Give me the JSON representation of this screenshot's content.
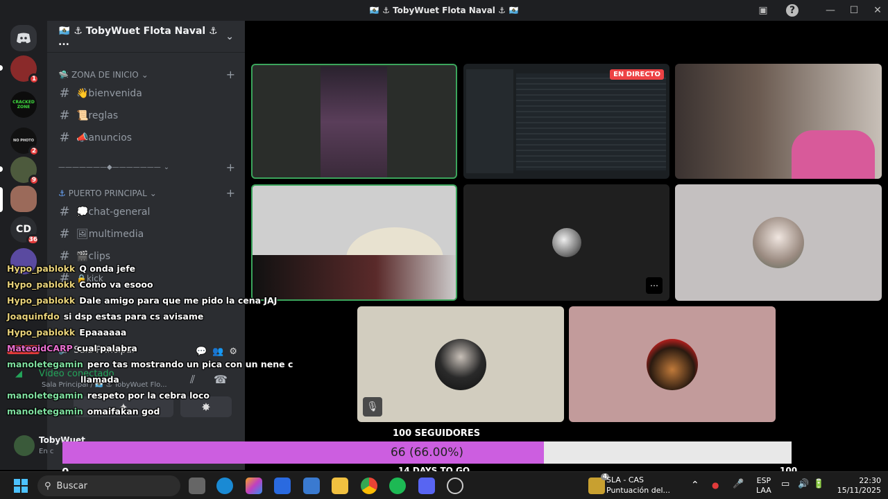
{
  "titlebar": {
    "title": "🇸🇲 ⚓ TobyWuet Flota Naval ⚓ 🇸🇲"
  },
  "server": {
    "name": "🇸🇲 ⚓ TobyWuet Flota Naval ⚓ ...",
    "categories": [
      {
        "label": "ZONA DE INICIO"
      },
      {
        "label": "———————◆———————"
      },
      {
        "label": "PUERTO PRINCIPAL"
      }
    ],
    "channels": [
      "👋bienvenida",
      "📜reglas",
      "📣anuncios",
      "💭chat-general",
      "🖼multimedia",
      "🎬clips",
      "🔒kick"
    ]
  },
  "guilds": [
    {
      "label": "",
      "badge": "1"
    },
    {
      "label": "CRACKED ZONE",
      "badge": ""
    },
    {
      "label": "NO PHOTO",
      "badge": "2"
    },
    {
      "label": "",
      "badge": "9"
    },
    {
      "label": "",
      "badge": ""
    },
    {
      "label": "CD",
      "badge": "36"
    }
  ],
  "stage": {
    "live_badge": "EN DIRECTO"
  },
  "chat": [
    {
      "user": "Hypo_pablokk",
      "msg": "Q onda jefe",
      "color": "#e8d27a"
    },
    {
      "user": "Hypo_pablokk",
      "msg": "Como va esooo",
      "color": "#e8d27a"
    },
    {
      "user": "Hypo_pablokk",
      "msg": "Dale amigo para que me pido la cena JAJ",
      "color": "#e8d27a"
    },
    {
      "user": "Joaquinfdo",
      "msg": "si dsp estas para cs avisame",
      "color": "#e8d27a"
    },
    {
      "user": "Hypo_pablokk",
      "msg": "Epaaaaaa",
      "color": "#e8d27a"
    },
    {
      "user": "MateoidCARP",
      "msg": "cual palabra",
      "color": "#e86fd0"
    },
    {
      "user": "manoletegamin",
      "msg": "pero tas mostrando un pica con un nene c",
      "color": "#7fe0a0"
    },
    {
      "user": "",
      "msg": "llamada",
      "color": "#7fe0a0"
    },
    {
      "user": "manoletegamin",
      "msg": "respeto por la cebra loco",
      "color": "#7fe0a0"
    },
    {
      "user": "manoletegamin",
      "msg": "omaifakan god",
      "color": "#7fe0a0"
    }
  ],
  "voice": {
    "channel": "Sala Principal",
    "status": "Vídeo conectado",
    "sub": "Sala Principal / 🇸🇲 ⚓ TobyWuet Flo...",
    "new_badge": "NUEVO"
  },
  "user": {
    "name": "TobyWuet",
    "status": "En c"
  },
  "goal": {
    "title": "100 SEGUIDORES",
    "current_label": "66 (66.00%)",
    "progress": 0.66,
    "min": "0",
    "max": "100",
    "days": "14 DAYS TO GO"
  },
  "taskbar": {
    "search": "Buscar",
    "weather_title": "SLA - CAS",
    "weather_sub": "Puntuación del...",
    "lang1": "ESP",
    "lang2": "LAA",
    "time": "22:30",
    "date": "15/11/2025",
    "notif_badge": "4"
  }
}
